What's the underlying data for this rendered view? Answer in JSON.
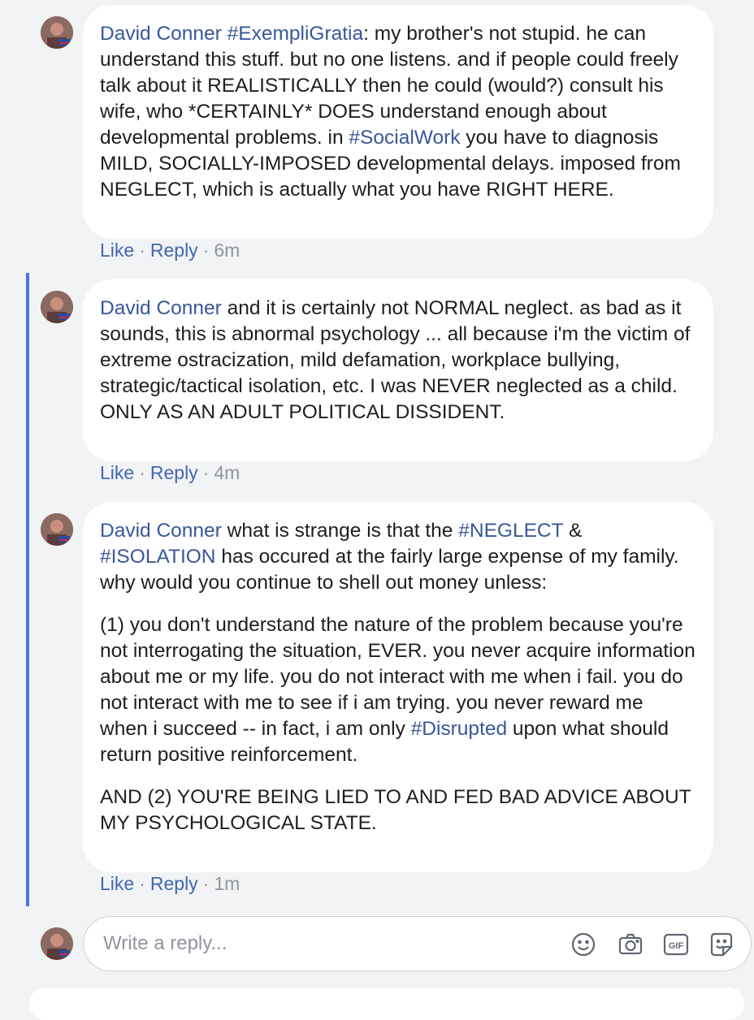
{
  "comments": [
    {
      "author": "David Conner",
      "paragraphs": [
        [
          {
            "t": " ",
            "tag": false
          },
          {
            "t": "#ExempliGratia",
            "tag": true
          },
          {
            "t": ": my brother's not stupid. he can understand this stuff. but no one listens. and if people could freely talk about it REALISTICALLY then he could (would?) consult his wife, who *CERTAINLY* DOES understand enough about developmental problems. in ",
            "tag": false
          },
          {
            "t": "#SocialWork",
            "tag": true
          },
          {
            "t": " you have to diagnosis MILD, SOCIALLY-IMPOSED developmental delays. imposed from NEGLECT, which is actually what you have RIGHT HERE.",
            "tag": false
          }
        ]
      ],
      "like": "Like",
      "reply": "Reply",
      "time": "6m"
    },
    {
      "author": "David Conner",
      "paragraphs": [
        [
          {
            "t": " and it is certainly not NORMAL neglect. as bad as it sounds, this is abnormal psychology ... all because i'm the victim of extreme ostracization, mild defamation, workplace bullying, strategic/tactical isolation, etc. I was NEVER neglected as a child. ONLY AS AN ADULT POLITICAL DISSIDENT.",
            "tag": false
          }
        ]
      ],
      "like": "Like",
      "reply": "Reply",
      "time": "4m"
    },
    {
      "author": "David Conner",
      "paragraphs": [
        [
          {
            "t": " what is strange is that the ",
            "tag": false
          },
          {
            "t": "#NEGLECT",
            "tag": true
          },
          {
            "t": " & ",
            "tag": false
          },
          {
            "t": "#ISOLATION",
            "tag": true
          },
          {
            "t": " has occured at the fairly large expense of my family. why would you continue to shell out money unless:",
            "tag": false
          }
        ],
        [
          {
            "t": "(1) you don't understand the nature of the problem because you're not interrogating the situation, EVER. you never acquire information about me or my life. you do not interact with me when i fail. you do not interact with me to see if i am trying. you never reward me when i succeed -- in fact, i am only ",
            "tag": false
          },
          {
            "t": "#Disrupted",
            "tag": true
          },
          {
            "t": " upon what should return positive reinforcement.",
            "tag": false
          }
        ],
        [
          {
            "t": "AND (2) YOU'RE BEING LIED TO AND FED BAD ADVICE ABOUT MY PSYCHOLOGICAL STATE.",
            "tag": false
          }
        ]
      ],
      "like": "Like",
      "reply": "Reply",
      "time": "1m"
    }
  ],
  "reply_box": {
    "placeholder": "Write a reply...",
    "icons": [
      "emoji-icon",
      "camera-icon",
      "gif-icon",
      "sticker-icon"
    ]
  },
  "colors": {
    "link": "#385898",
    "action_link": "#4267b2",
    "thread_line": "#4a76e8",
    "background": "#f2f3f5"
  }
}
